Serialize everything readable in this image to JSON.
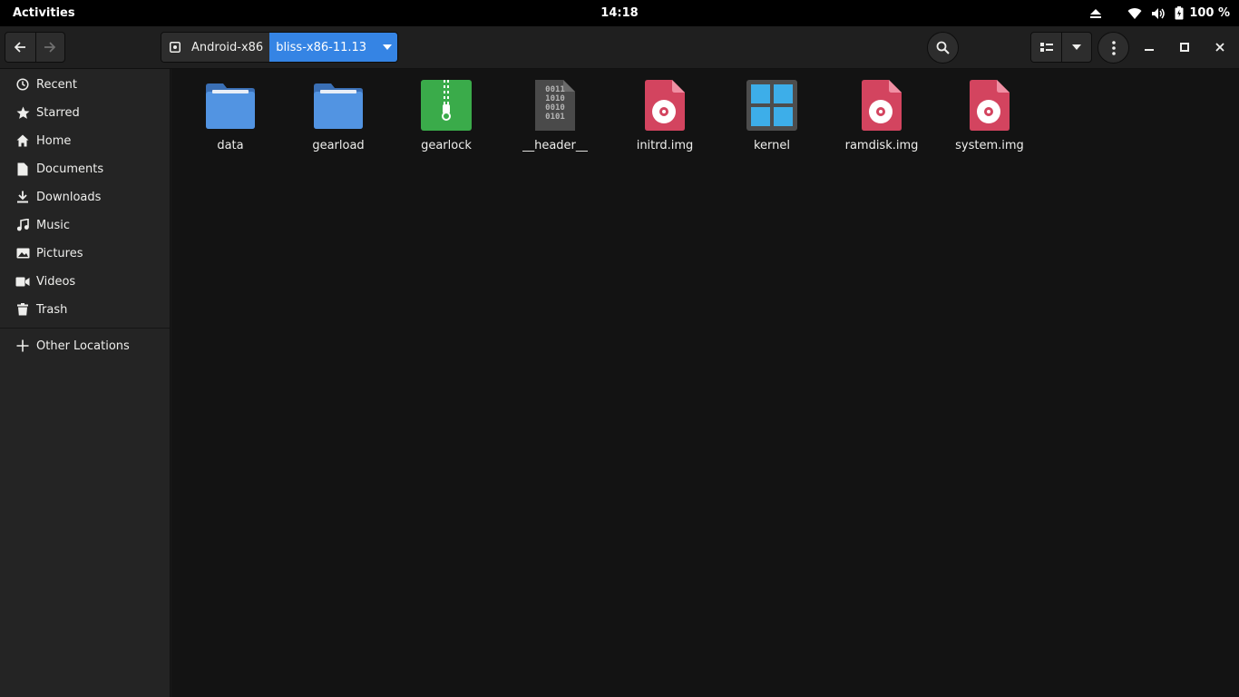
{
  "topbar": {
    "activities": "Activities",
    "clock": "14:18",
    "battery_percent": "100 %",
    "icons": [
      "eject-icon",
      "wifi-icon",
      "volume-icon",
      "battery-icon"
    ]
  },
  "headerbar": {
    "path": [
      "Android-x86",
      "bliss-x86-11.13"
    ],
    "icons": [
      "back-arrow-icon",
      "forward-arrow-icon",
      "drive-icon",
      "dropdown-arrow-icon",
      "search-icon",
      "list-view-icon",
      "chevron-down-icon",
      "kebab-menu-icon",
      "minimize-icon",
      "maximize-icon",
      "close-icon"
    ]
  },
  "sidebar": {
    "items": [
      {
        "label": "Recent",
        "icon": "clock-icon"
      },
      {
        "label": "Starred",
        "icon": "star-icon"
      },
      {
        "label": "Home",
        "icon": "home-icon"
      },
      {
        "label": "Documents",
        "icon": "document-icon"
      },
      {
        "label": "Downloads",
        "icon": "download-icon"
      },
      {
        "label": "Music",
        "icon": "music-icon"
      },
      {
        "label": "Pictures",
        "icon": "picture-icon"
      },
      {
        "label": "Videos",
        "icon": "video-icon"
      },
      {
        "label": "Trash",
        "icon": "trash-icon"
      }
    ],
    "other_locations": "Other Locations"
  },
  "files": [
    {
      "name": "data",
      "type": "folder"
    },
    {
      "name": "gearload",
      "type": "folder"
    },
    {
      "name": "gearlock",
      "type": "archive"
    },
    {
      "name": "__header__",
      "type": "binary"
    },
    {
      "name": "initrd.img",
      "type": "disk-image"
    },
    {
      "name": "kernel",
      "type": "executable"
    },
    {
      "name": "ramdisk.img",
      "type": "disk-image"
    },
    {
      "name": "system.img",
      "type": "disk-image"
    }
  ],
  "colors": {
    "accent": "#3584e4",
    "folder": "#4a86cf",
    "archive": "#3aab4a",
    "disk_image": "#d3445f",
    "kernel_tiles": "#3daee9"
  }
}
